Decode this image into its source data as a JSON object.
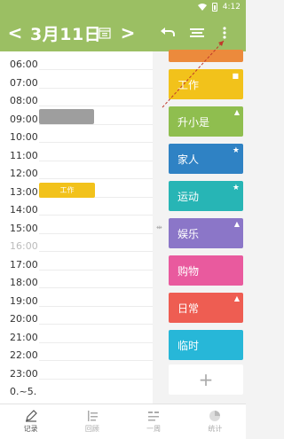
{
  "status": {
    "time": "4:12"
  },
  "toolbar": {
    "prev": "<",
    "date": "3月11日",
    "next": ">",
    "today_icon": "calendar-today-icon",
    "undo_icon": "undo-icon",
    "filter_icon": "filter-icon",
    "more_icon": "more-vert-icon"
  },
  "time_labels": [
    "06:00",
    "07:00",
    "08:00",
    "09:00",
    "10:00",
    "11:00",
    "12:00",
    "13:00",
    "14:00",
    "15:00",
    "16:00",
    "17:00",
    "18:00",
    "19:00",
    "20:00",
    "21:00",
    "22:00",
    "23:00",
    "0.~5."
  ],
  "events": [
    {
      "label": ""
    },
    {
      "label": "工作"
    }
  ],
  "categories": [
    {
      "label": "",
      "color": "#ec8a3c"
    },
    {
      "label": "工作",
      "color": "#f2c21b"
    },
    {
      "label": "升小是",
      "color": "#8fbe4f"
    },
    {
      "label": "家人",
      "color": "#2f82c4"
    },
    {
      "label": "运动",
      "color": "#27b5b5"
    },
    {
      "label": "娱乐",
      "color": "#8b76c8"
    },
    {
      "label": "购物",
      "color": "#e95a9e"
    },
    {
      "label": "日常",
      "color": "#ee5d52"
    },
    {
      "label": "临时",
      "color": "#27b7d8"
    }
  ],
  "add_label": "+",
  "nav": [
    {
      "label": "记录",
      "icon": "pen-icon"
    },
    {
      "label": "回顾",
      "icon": "list-icon"
    },
    {
      "label": "一周",
      "icon": "week-icon"
    },
    {
      "label": "统计",
      "icon": "pie-chart-icon"
    }
  ]
}
